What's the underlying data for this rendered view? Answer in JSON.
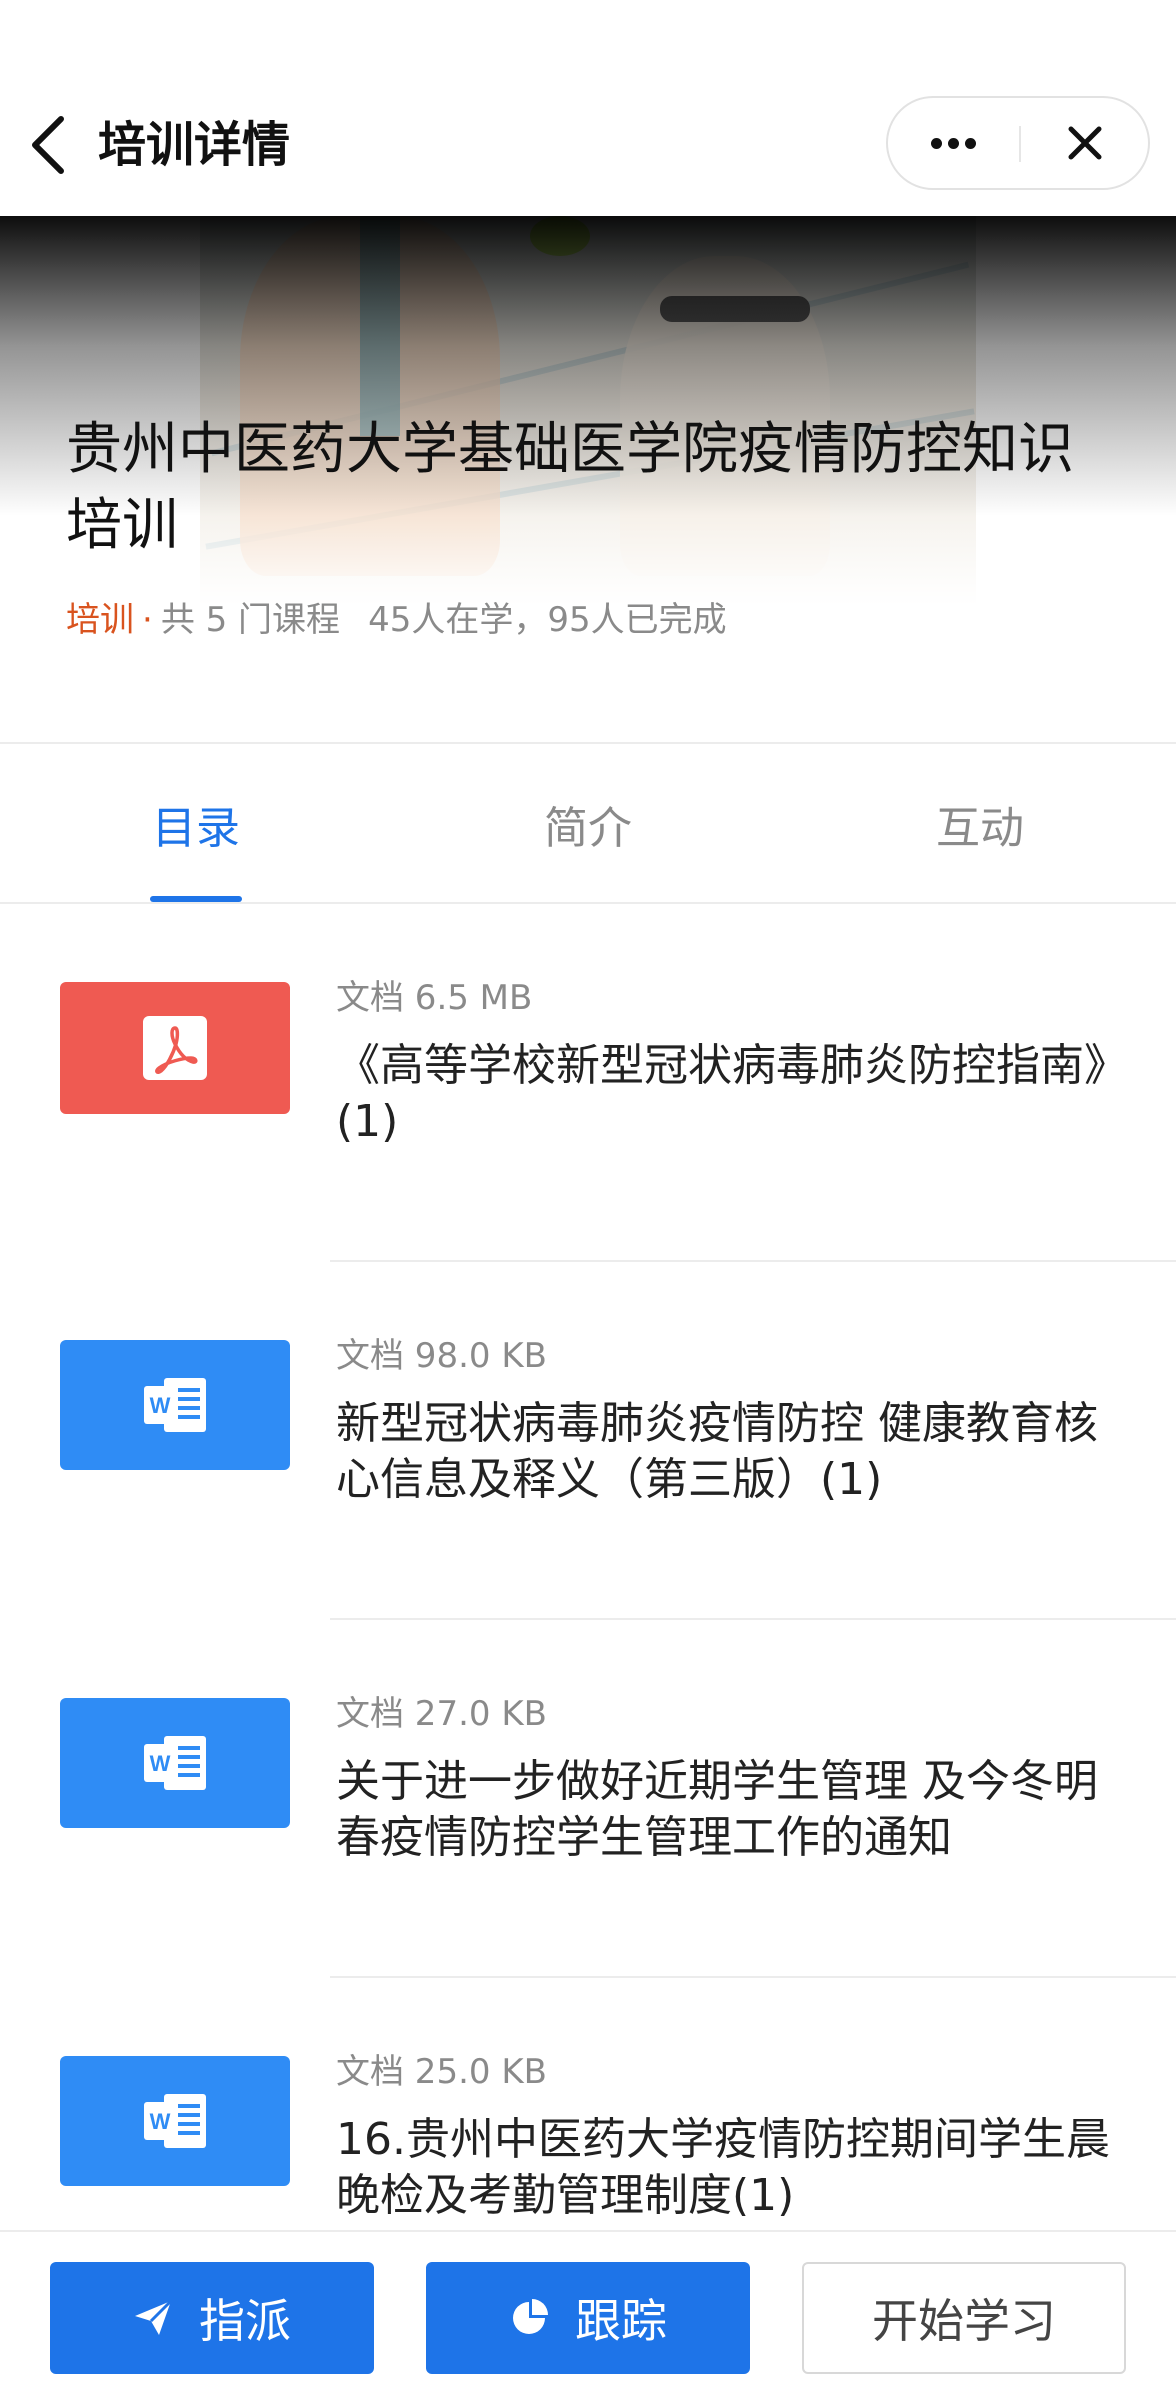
{
  "header": {
    "title": "培训详情"
  },
  "banner": {
    "title": "贵州中医药大学基础医学院疫情防控知识培训",
    "tag": "培训",
    "separator": "·",
    "course_count": "共 5 门课程",
    "stats": "45人在学，95人已完成"
  },
  "tabs": [
    {
      "label": "目录"
    },
    {
      "label": "简介"
    },
    {
      "label": "互动"
    }
  ],
  "items": [
    {
      "meta": "文档 6.5 MB",
      "title": "《高等学校新型冠状病毒肺炎防控指南》(1)",
      "icon": "pdf-icon"
    },
    {
      "meta": "文档 98.0 KB",
      "title": "新型冠状病毒肺炎疫情防控 健康教育核心信息及释义（第三版）(1)",
      "icon": "word-icon"
    },
    {
      "meta": "文档 27.0 KB",
      "title": "关于进一步做好近期学生管理 及今冬明春疫情防控学生管理工作的通知",
      "icon": "word-icon"
    },
    {
      "meta": "文档 25.0 KB",
      "title": "16.贵州中医药大学疫情防控期间学生晨晚检及考勤管理制度(1)",
      "icon": "word-icon"
    }
  ],
  "bottom": {
    "assign": "指派",
    "track": "跟踪",
    "start": "开始学习"
  },
  "colors": {
    "accent": "#1e74e8",
    "tag": "#d9531e",
    "pdf": "#ef5a52",
    "word": "#2f8cf5"
  }
}
